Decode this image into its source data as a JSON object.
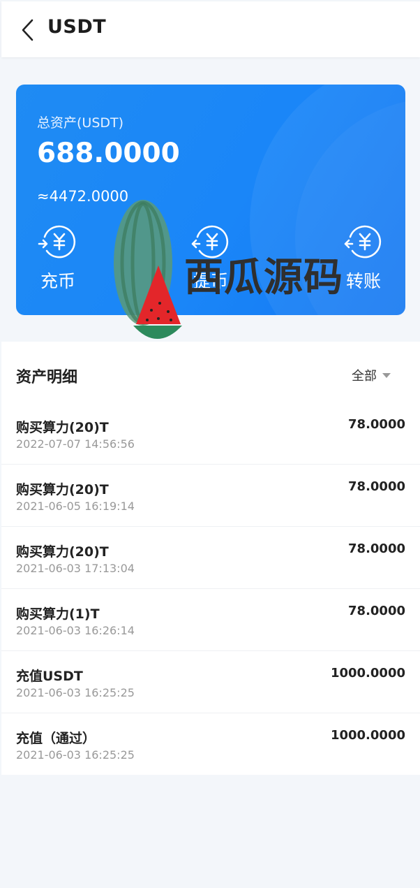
{
  "header": {
    "title": "USDT"
  },
  "card": {
    "total_label": "总资产(USDT)",
    "total_value": "688.0000",
    "approx_value": "≈4472.0000",
    "actions": [
      {
        "label": "充币",
        "icon": "yen-in-icon"
      },
      {
        "label": "提币",
        "icon": "yen-out-icon"
      },
      {
        "label": "转账",
        "icon": "yen-transfer-icon"
      }
    ]
  },
  "watermark": {
    "text": "西瓜源码"
  },
  "details": {
    "title": "资产明细",
    "filter_label": "全部",
    "records": [
      {
        "title": "购买算力(20)T",
        "time": "2022-07-07 14:56:56",
        "amount": "78.0000"
      },
      {
        "title": "购买算力(20)T",
        "time": "2021-06-05 16:19:14",
        "amount": "78.0000"
      },
      {
        "title": "购买算力(20)T",
        "time": "2021-06-03 17:13:04",
        "amount": "78.0000"
      },
      {
        "title": "购买算力(1)T",
        "time": "2021-06-03 16:26:14",
        "amount": "78.0000"
      },
      {
        "title": "充值USDT",
        "time": "2021-06-03 16:25:25",
        "amount": "1000.0000"
      },
      {
        "title": "充值（通过）",
        "time": "2021-06-03 16:25:25",
        "amount": "1000.0000"
      }
    ]
  },
  "colors": {
    "card_blue": "#1a86f8",
    "page_bg": "#f3f6fa"
  }
}
